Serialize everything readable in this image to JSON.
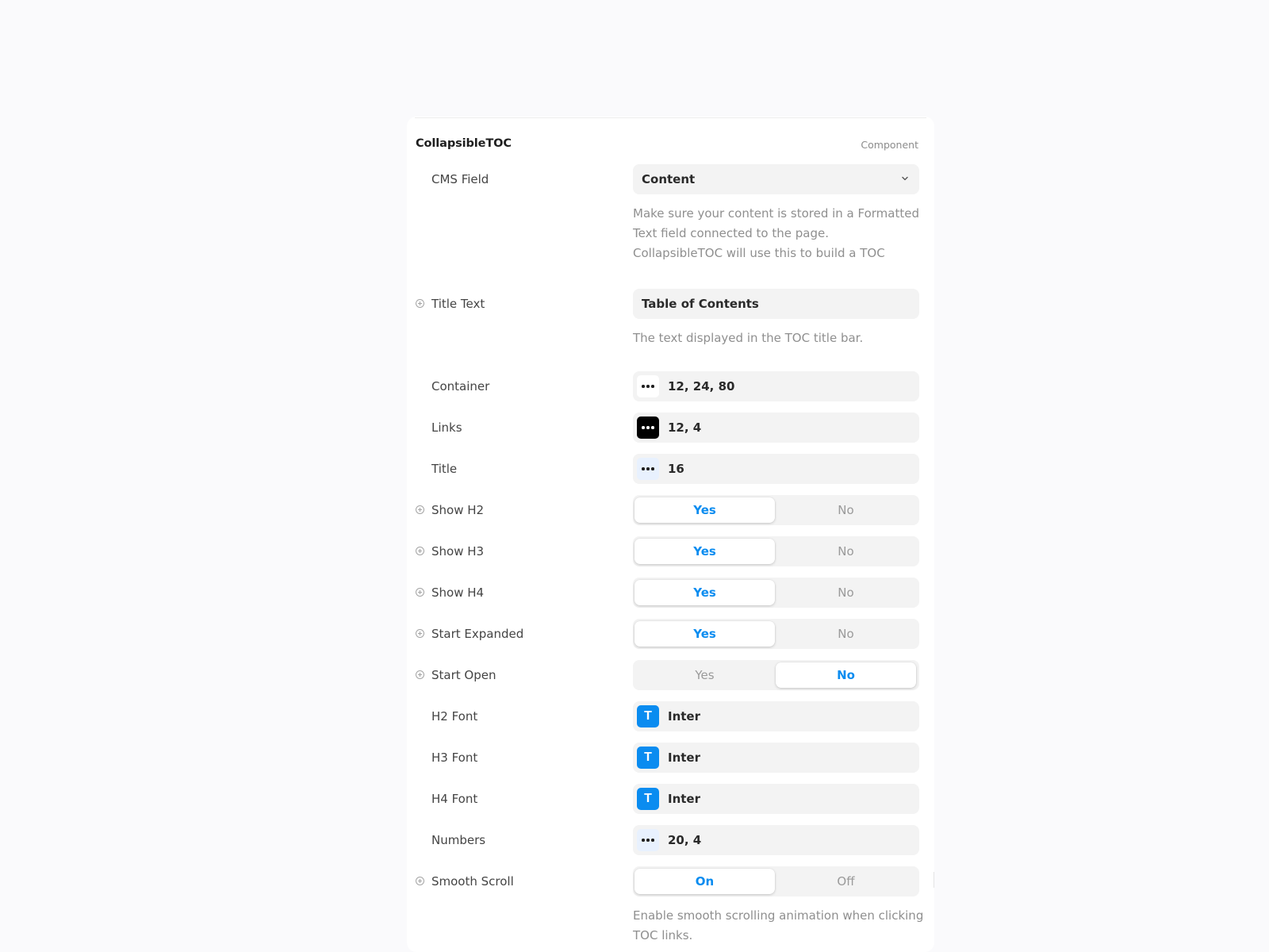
{
  "header": {
    "name": "CollapsibleTOC",
    "kind": "Component"
  },
  "cms_field": {
    "label": "CMS Field",
    "value": "Content",
    "help": [
      "Make sure your content is stored in a Formatted",
      "Text field connected to the page.",
      "CollapsibleTOC will use this to build a TOC"
    ]
  },
  "title_text": {
    "label": "Title Text",
    "value": "Table of Contents",
    "help": [
      "The text displayed in the TOC title bar."
    ]
  },
  "container": {
    "label": "Container",
    "value": "12, 24, 80",
    "icon": "more-dots-icon"
  },
  "links": {
    "label": "Links",
    "value": "12, 4",
    "icon": "more-dots-icon"
  },
  "title": {
    "label": "Title",
    "value": "16",
    "icon": "more-dots-icon"
  },
  "show_h2": {
    "label": "Show H2",
    "yes": "Yes",
    "no": "No",
    "selected": "Yes"
  },
  "show_h3": {
    "label": "Show H3",
    "yes": "Yes",
    "no": "No",
    "selected": "Yes"
  },
  "show_h4": {
    "label": "Show H4",
    "yes": "Yes",
    "no": "No",
    "selected": "Yes"
  },
  "start_expanded": {
    "label": "Start Expanded",
    "yes": "Yes",
    "no": "No",
    "selected": "Yes"
  },
  "start_open": {
    "label": "Start Open",
    "yes": "Yes",
    "no": "No",
    "selected": "No"
  },
  "h2_font": {
    "label": "H2 Font",
    "value": "Inter",
    "glyph": "T"
  },
  "h3_font": {
    "label": "H3 Font",
    "value": "Inter",
    "glyph": "T"
  },
  "h4_font": {
    "label": "H4 Font",
    "value": "Inter",
    "glyph": "T"
  },
  "numbers": {
    "label": "Numbers",
    "value": "20, 4",
    "icon": "more-dots-icon"
  },
  "smooth_scroll": {
    "label": "Smooth Scroll",
    "on": "On",
    "off": "Off",
    "selected": "On",
    "help": [
      "Enable smooth scrolling animation when clicking",
      "TOC links."
    ]
  },
  "colors": {
    "accent": "#0a8cf0",
    "control_bg": "#f3f3f3",
    "page_bg": "#fafafc"
  }
}
